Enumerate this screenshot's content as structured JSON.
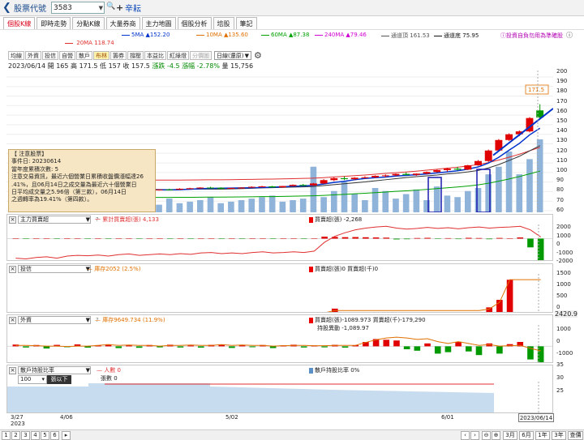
{
  "header": {
    "back_icon": "chevron-left-icon",
    "title": "股票代號",
    "stock_code": "3583",
    "stock_name": "辛耘"
  },
  "tabs": [
    {
      "label": "個股K線",
      "active": true
    },
    {
      "label": "即時走勢",
      "active": false
    },
    {
      "label": "分點K線",
      "active": false
    },
    {
      "label": "大量券商",
      "active": false
    },
    {
      "label": "主力地圖",
      "active": false
    },
    {
      "label": "個股分析",
      "active": false
    },
    {
      "label": "培股",
      "active": false
    },
    {
      "label": "筆記",
      "active": false
    }
  ],
  "ma_legend": [
    {
      "label": "5MA",
      "value": "▲152.20",
      "color": "#0033cc"
    },
    {
      "label": "10MA",
      "value": "▲135.60",
      "color": "#e07000"
    },
    {
      "label": "60MA",
      "value": "▲87.38",
      "color": "#00a000"
    },
    {
      "label": "240MA",
      "value": "▲79.46",
      "color": "#d000d0"
    },
    {
      "label": "通道頂",
      "value": "161.53",
      "color": "#555555"
    },
    {
      "label": "通道底",
      "value": "75.95",
      "color": "#111111"
    }
  ],
  "ma_legend_2": {
    "label": "20MA",
    "value": "118.74",
    "color": "#e03030"
  },
  "disclaimer": "投資自負勿用為準確股",
  "chart_toolbar": {
    "buttons": [
      "均線",
      "外資",
      "投信",
      "自營",
      "散戶",
      "布林",
      "籌券",
      "撐壓",
      "本益比",
      "紅綠燈",
      "分價圖"
    ],
    "active": "布林",
    "select": "日線(還原)"
  },
  "price_info": {
    "date": "2023/06/14",
    "open_label": "開",
    "open": "165",
    "high_label": "高",
    "high": "171.5",
    "low_label": "低",
    "low": "157",
    "close_label": "收",
    "close": "157.5",
    "change_label": "漲跌",
    "change": "-4.5",
    "pct_label": "漲幅",
    "pct": "-2.78%",
    "vol_label": "量",
    "vol": "15,756"
  },
  "price_axis": [
    "200",
    "190",
    "180",
    "170",
    "160",
    "150",
    "140",
    "130",
    "120",
    "110",
    "100",
    "90",
    "80",
    "70",
    "60"
  ],
  "price_tag": "171.5",
  "notice": {
    "lines": [
      "【 注意股票】",
      "事件日: 20230614",
      "當年度累積次數: 5",
      "注意交易資訊，最近六個營業日累積收盤價漲幅達26",
      ".41%，且06月14日之成交量為最近六十個營業日",
      "日平均成交量之5.96倍（第三款），06月14日",
      "之週轉率為19.41%（第四款）。"
    ]
  },
  "panel_main_force": {
    "select": "主力買賣超",
    "legend_cum": "一 累計買賣超(張) 4,133",
    "legend_bs": "買賣超(張) -2,268",
    "axis": [
      "2000",
      "1000",
      "0",
      "-1000",
      "-2000"
    ],
    "bars": [
      30,
      -20,
      25,
      10,
      -30,
      40,
      20,
      -10,
      15,
      -25,
      35,
      30,
      -40,
      20,
      15,
      -15,
      25,
      -20,
      40,
      10,
      -30,
      20,
      -20,
      30,
      15,
      -25,
      10,
      20,
      -15,
      35,
      200,
      180,
      150,
      160,
      140,
      120,
      100,
      -80,
      -60,
      60,
      80,
      -40,
      50,
      -50,
      80,
      60,
      -60,
      70,
      30,
      120,
      -900,
      -2268
    ],
    "cum": [
      0.1,
      0.08,
      0.12,
      0.14,
      0.1,
      0.16,
      0.18,
      0.17,
      0.19,
      0.16,
      0.2,
      0.22,
      0.18,
      0.2,
      0.22,
      0.2,
      0.23,
      0.21,
      0.25,
      0.26,
      0.23,
      0.25,
      0.23,
      0.26,
      0.28,
      0.25,
      0.26,
      0.28,
      0.26,
      0.3,
      0.55,
      0.72,
      0.82,
      0.9,
      0.95,
      0.98,
      1.0,
      0.95,
      0.92,
      0.94,
      0.97,
      0.94,
      0.96,
      0.93,
      0.96,
      0.98,
      0.95,
      0.97,
      0.98,
      1.0,
      0.9,
      0.7
    ]
  },
  "panel_investment_trust": {
    "select": "投信",
    "legend_hold": "庫存2052 (2.5%)",
    "legend_bs": "買賣超(張)0 買賣超(千)0",
    "axis": [
      "1500",
      "1000",
      "500",
      "0"
    ],
    "value_tag": "2420.9",
    "bars": [
      0,
      0,
      0,
      0,
      0,
      0,
      0,
      0,
      0,
      0,
      0,
      0,
      0,
      0,
      0,
      0,
      0,
      0,
      0,
      0,
      0,
      0,
      0,
      0,
      0,
      0,
      0,
      0,
      0,
      0,
      0,
      150,
      0,
      0,
      0,
      0,
      0,
      0,
      0,
      0,
      0,
      0,
      0,
      0,
      0,
      0,
      200,
      500,
      1300,
      0,
      0,
      0
    ],
    "hold": [
      0.02,
      0.02,
      0.02,
      0.02,
      0.02,
      0.02,
      0.02,
      0.02,
      0.02,
      0.02,
      0.02,
      0.02,
      0.02,
      0.02,
      0.02,
      0.02,
      0.02,
      0.02,
      0.02,
      0.02,
      0.02,
      0.02,
      0.02,
      0.02,
      0.02,
      0.02,
      0.02,
      0.02,
      0.02,
      0.02,
      0.02,
      0.08,
      0.08,
      0.08,
      0.08,
      0.08,
      0.08,
      0.08,
      0.08,
      0.08,
      0.08,
      0.08,
      0.08,
      0.08,
      0.08,
      0.08,
      0.12,
      0.3,
      0.9,
      0.9,
      0.9,
      0.9
    ]
  },
  "panel_foreign": {
    "select": "外資",
    "legend_hold": "庫存9649.734 (11.9%)",
    "legend_bs": "買賣超(張)-1089.973 買賣超(千)-179,290",
    "legend_ratio": "持股異動 -1,089.97",
    "axis": [
      "1000",
      "0",
      "-1000"
    ],
    "bars": [
      120,
      -80,
      90,
      -150,
      100,
      -60,
      130,
      -90,
      80,
      140,
      -120,
      70,
      -100,
      90,
      -70,
      110,
      -80,
      60,
      -90,
      100,
      120,
      -110,
      80,
      -60,
      90,
      -120,
      70,
      110,
      -80,
      60,
      -70,
      100,
      -90,
      80,
      300,
      500,
      450,
      400,
      -200,
      -300,
      200,
      -500,
      -400,
      300,
      -350,
      -600,
      200,
      -500,
      150,
      300,
      -900,
      -1090
    ],
    "hold": [
      0.5,
      0.5,
      0.49,
      0.48,
      0.48,
      0.47,
      0.48,
      0.48,
      0.5,
      0.52,
      0.5,
      0.51,
      0.5,
      0.5,
      0.48,
      0.5,
      0.5,
      0.51,
      0.5,
      0.5,
      0.52,
      0.5,
      0.51,
      0.5,
      0.5,
      0.48,
      0.49,
      0.5,
      0.5,
      0.49,
      0.49,
      0.5,
      0.5,
      0.5,
      0.58,
      0.65,
      0.7,
      0.72,
      0.7,
      0.66,
      0.68,
      0.6,
      0.55,
      0.6,
      0.55,
      0.5,
      0.52,
      0.48,
      0.49,
      0.5,
      0.42,
      0.35
    ]
  },
  "panel_retail": {
    "select": "散戶持股比率",
    "legend_people": "人數 0",
    "legend_change": "張數 0",
    "legend_ratio": "散戶持股比率 0%",
    "axis": [
      "35",
      "30",
      "25"
    ],
    "hist_input": "100",
    "hist_label": "張以下"
  },
  "x_axis": [
    {
      "label": "3/27"
    },
    {
      "label": "2023"
    },
    {
      "label": "4/06"
    },
    {
      "label": "5/02"
    },
    {
      "label": "6/01"
    }
  ],
  "date_badge": "2023/06/14",
  "footer": {
    "pages": [
      "1",
      "2",
      "3",
      "4",
      "5",
      "6"
    ],
    "buttons": [
      "3月",
      "6月",
      "1年",
      "3年",
      "查價"
    ]
  },
  "chart_data": {
    "type": "candlestick",
    "title": "",
    "ylim": [
      60,
      200
    ],
    "candles": [
      [
        82,
        83,
        81,
        82.5
      ],
      [
        82.5,
        83,
        81.5,
        82
      ],
      [
        82,
        82.8,
        81,
        81.5
      ],
      [
        81.5,
        82.5,
        81,
        82
      ],
      [
        82,
        83,
        81.5,
        82.8
      ],
      [
        82.8,
        83.5,
        82,
        82.5
      ],
      [
        82.5,
        83,
        81.5,
        81.8
      ],
      [
        81.8,
        82.5,
        80.5,
        82
      ],
      [
        82,
        83,
        81.5,
        82.6
      ],
      [
        82.6,
        83.8,
        82,
        83.2
      ],
      [
        83.2,
        83.8,
        82.5,
        82.8
      ],
      [
        82.8,
        83.5,
        81.8,
        82
      ],
      [
        82,
        82.5,
        80.5,
        81
      ],
      [
        81,
        82,
        80,
        81.5
      ],
      [
        81.5,
        82.5,
        81,
        82.2
      ],
      [
        82.2,
        83,
        81.5,
        82
      ],
      [
        82,
        83.5,
        81.8,
        83
      ],
      [
        83,
        84,
        82.5,
        83.5
      ],
      [
        83.5,
        84.5,
        83,
        84.2
      ],
      [
        84.2,
        85,
        83.5,
        84
      ],
      [
        84,
        84.5,
        82.5,
        83
      ],
      [
        83,
        84,
        82.5,
        83.8
      ],
      [
        83.8,
        84.5,
        83,
        84.2
      ],
      [
        84.2,
        85.5,
        84,
        85
      ],
      [
        85,
        86,
        84.5,
        85.5
      ],
      [
        85.5,
        86,
        84,
        84.5
      ],
      [
        84.5,
        86,
        84,
        85.8
      ],
      [
        85.8,
        87.5,
        85.5,
        87
      ],
      [
        87,
        88,
        86,
        86.5
      ],
      [
        86.5,
        89,
        86,
        88.5
      ],
      [
        88.5,
        93,
        88,
        92
      ],
      [
        92,
        95,
        91,
        94
      ],
      [
        94,
        96,
        92,
        93
      ],
      [
        93,
        95,
        92,
        94.5
      ],
      [
        94.5,
        96,
        93.5,
        95
      ],
      [
        95,
        97,
        94,
        96.5
      ],
      [
        96.5,
        98,
        95,
        97
      ],
      [
        97,
        99,
        96,
        98.5
      ],
      [
        98.5,
        100,
        97,
        97.5
      ],
      [
        97.5,
        99,
        96.5,
        98.8
      ],
      [
        98.8,
        101,
        98,
        100.5
      ],
      [
        100.5,
        103,
        100,
        102.5
      ],
      [
        102.5,
        105,
        101,
        104
      ],
      [
        104,
        106,
        102,
        103
      ],
      [
        103,
        108,
        102.5,
        107.5
      ],
      [
        107.5,
        113,
        107,
        112
      ],
      [
        112,
        124,
        111,
        123
      ],
      [
        123,
        135,
        122,
        134
      ],
      [
        134,
        141,
        133,
        140
      ],
      [
        140,
        144,
        138,
        143
      ],
      [
        143,
        158,
        142,
        157
      ],
      [
        165,
        171.5,
        157,
        157.5
      ]
    ],
    "volume": [
      10,
      12,
      8,
      6,
      15,
      5,
      7,
      9,
      4,
      8,
      11,
      6,
      7,
      8,
      5,
      9,
      6,
      7,
      8,
      10,
      6,
      7,
      8,
      9,
      10,
      11,
      7,
      8,
      9,
      30,
      10,
      14,
      20,
      12,
      8,
      16,
      14,
      9,
      12,
      15,
      8,
      17,
      11,
      10,
      14,
      16,
      25,
      30,
      40,
      25,
      35,
      48
    ]
  }
}
